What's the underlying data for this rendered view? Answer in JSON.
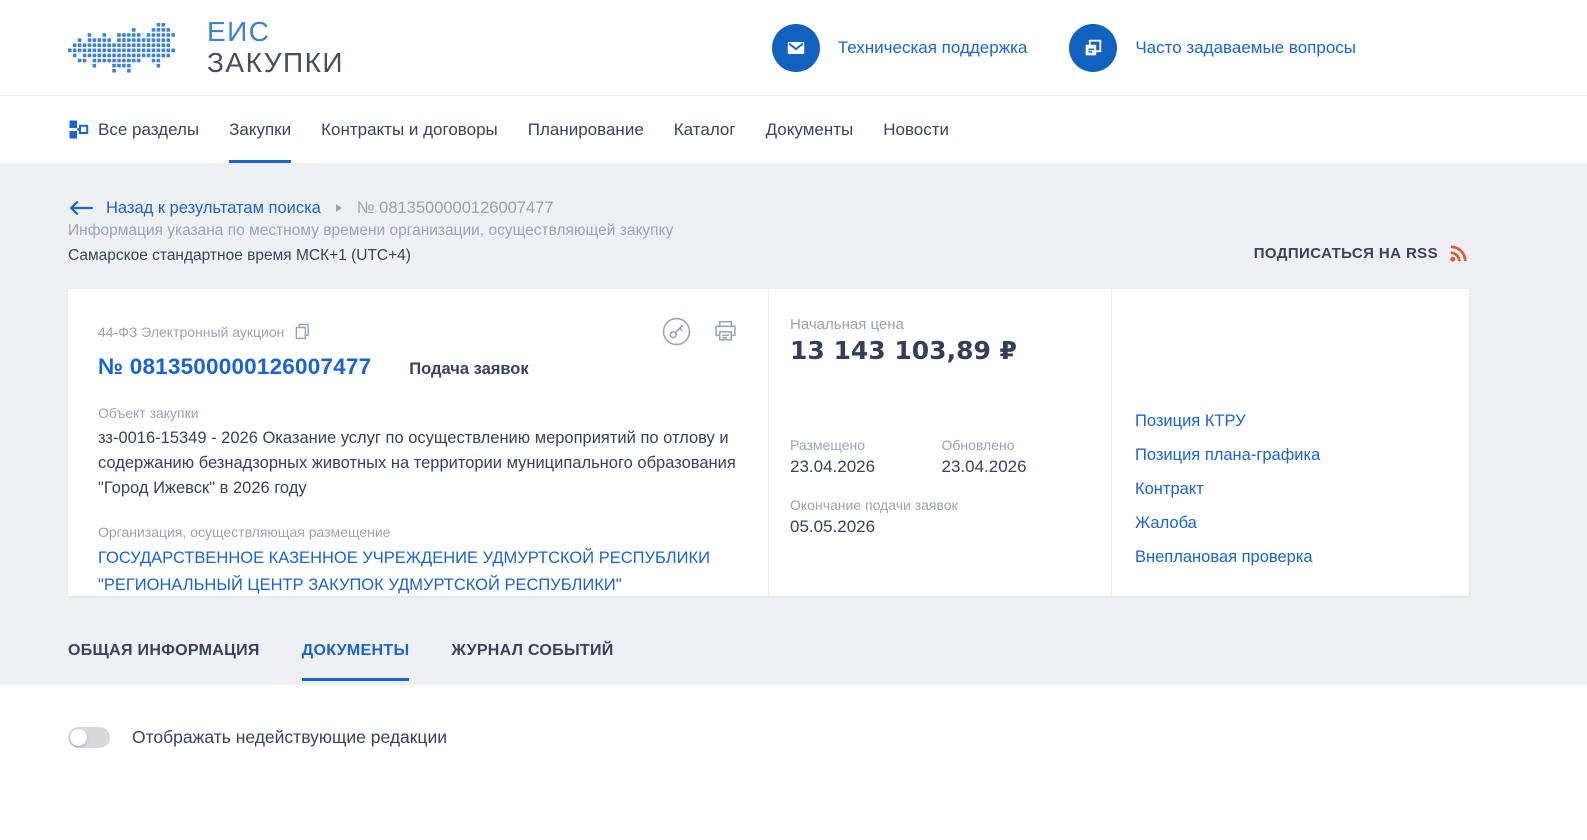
{
  "colors": {
    "accent_blue": "#1A63D2",
    "icon_circle_blue": "#1161BE",
    "navy_text": "#39425C",
    "muted_label": "#9AA3B4",
    "page_gray": "#EEF0F3",
    "rss_orange": "#E25740",
    "logo_blue": "#3C80D8"
  },
  "header": {
    "logo_line1": "ЕИС",
    "logo_line2": "ЗАКУПКИ",
    "support_label": "Техническая поддержка",
    "faq_label": "Часто задаваемые вопросы"
  },
  "nav": {
    "all_sections": "Все разделы",
    "items": [
      {
        "label": "Закупки",
        "active": true
      },
      {
        "label": "Контракты и договоры",
        "active": false
      },
      {
        "label": "Планирование",
        "active": false
      },
      {
        "label": "Каталог",
        "active": false
      },
      {
        "label": "Документы",
        "active": false
      },
      {
        "label": "Новости",
        "active": false
      }
    ]
  },
  "breadcrumb": {
    "back_label": "Назад к результатам поиска",
    "current": "№ 0813500000126007477"
  },
  "notice": {
    "line1": "Информация указана по местному времени организации, осуществляющей закупку",
    "line2": "Самарское стандартное время МСК+1 (UTC+4)",
    "rss_label": "ПОДПИСАТЬСЯ НА RSS"
  },
  "card": {
    "law_label": "44-ФЗ  Электронный аукцион",
    "number": "№ 0813500000126007477",
    "status": "Подача заявок",
    "object_label": "Объект закупки",
    "object_text": "зз-0016-15349 - 2026 Оказание услуг по осуществлению мероприятий по отлову и содержанию безнадзорных животных на территории муниципального образования \"Город Ижевск\" в 2026 году",
    "org_label": "Организация, осуществляющая размещение",
    "org_name": "ГОСУДАРСТВЕННОЕ КАЗЕННОЕ УЧРЕЖДЕНИЕ УДМУРТСКОЙ РЕСПУБЛИКИ \"РЕГИОНАЛЬНЫЙ ЦЕНТР ЗАКУПОК УДМУРТСКОЙ РЕСПУБЛИКИ\"",
    "price_label": "Начальная цена",
    "price_value": "13 143 103,89 ₽",
    "placed_label": "Размещено",
    "placed_date": "23.04.2026",
    "updated_label": "Обновлено",
    "updated_date": "23.04.2026",
    "deadline_label": "Окончание подачи заявок",
    "deadline_date": "05.05.2026",
    "links": [
      "Позиция КТРУ",
      "Позиция плана-графика",
      "Контракт",
      "Жалоба",
      "Внеплановая проверка"
    ]
  },
  "tabs": [
    {
      "label": "ОБЩАЯ ИНФОРМАЦИЯ",
      "active": false
    },
    {
      "label": "ДОКУМЕНТЫ",
      "active": true
    },
    {
      "label": "ЖУРНАЛ СОБЫТИЙ",
      "active": false
    }
  ],
  "documents_section": {
    "toggle_label": "Отображать недействующие редакции",
    "toggle_state": "off"
  }
}
